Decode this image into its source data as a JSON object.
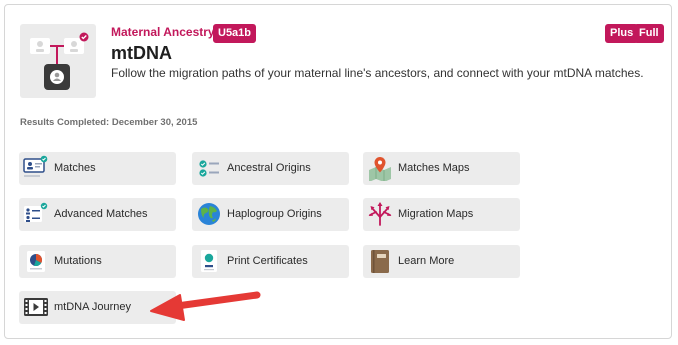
{
  "header": {
    "eyebrow": "Maternal Ancestry",
    "haplogroup_badge": "U5a1b",
    "badges": [
      "Plus",
      "Full"
    ],
    "title": "mtDNA",
    "description": "Follow the migration paths of your maternal line's ancestors, and connect with your mtDNA matches."
  },
  "results_completed": "Results Completed: December 30, 2015",
  "tiles": [
    {
      "label": "Matches",
      "icon": "matches-icon"
    },
    {
      "label": "Ancestral Origins",
      "icon": "ancestral-origins-icon"
    },
    {
      "label": "Matches Maps",
      "icon": "map-pin-icon"
    },
    {
      "label": "Advanced Matches",
      "icon": "advanced-matches-icon"
    },
    {
      "label": "Haplogroup Origins",
      "icon": "globe-icon"
    },
    {
      "label": "Migration Maps",
      "icon": "migration-arrows-icon"
    },
    {
      "label": "Mutations",
      "icon": "mutations-chart-icon"
    },
    {
      "label": "Print Certificates",
      "icon": "certificate-icon"
    },
    {
      "label": "Learn More",
      "icon": "book-icon"
    },
    {
      "label": "mtDNA Journey",
      "icon": "video-icon"
    }
  ],
  "colors": {
    "accent": "#c2185b",
    "teal": "#1aa79c",
    "tile_bg": "#ececec",
    "annotation_arrow": "#e53935"
  }
}
